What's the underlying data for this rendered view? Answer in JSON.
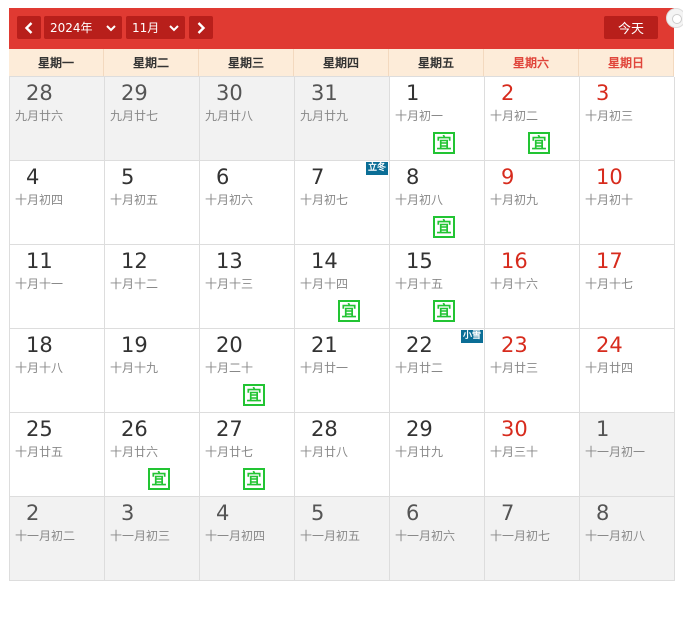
{
  "toolbar": {
    "year_label": "2024年",
    "month_label": "11月",
    "today_label": "今天",
    "prev_icon": "chevron-left-icon",
    "next_icon": "chevron-right-icon"
  },
  "weekdays": [
    {
      "label": "星期一",
      "weekend": false
    },
    {
      "label": "星期二",
      "weekend": false
    },
    {
      "label": "星期三",
      "weekend": false
    },
    {
      "label": "星期四",
      "weekend": false
    },
    {
      "label": "星期五",
      "weekend": false
    },
    {
      "label": "星期六",
      "weekend": true
    },
    {
      "label": "星期日",
      "weekend": true
    }
  ],
  "yi_label": "宜",
  "colors": {
    "toolbar_bg": "#e03a32",
    "button_bg": "#b81f1b",
    "weekend_text": "#d72b1d",
    "yi_green": "#22c433",
    "solar_term_badge": "#0b6e96"
  },
  "days": [
    {
      "day": "28",
      "lunar": "九月廿六",
      "other": true
    },
    {
      "day": "29",
      "lunar": "九月廿七",
      "other": true
    },
    {
      "day": "30",
      "lunar": "九月廿八",
      "other": true
    },
    {
      "day": "31",
      "lunar": "九月廿九",
      "other": true
    },
    {
      "day": "1",
      "lunar": "十月初一",
      "yi": true
    },
    {
      "day": "2",
      "lunar": "十月初二",
      "weekend": true,
      "yi": true
    },
    {
      "day": "3",
      "lunar": "十月初三",
      "weekend": true
    },
    {
      "day": "4",
      "lunar": "十月初四"
    },
    {
      "day": "5",
      "lunar": "十月初五"
    },
    {
      "day": "6",
      "lunar": "十月初六"
    },
    {
      "day": "7",
      "lunar": "十月初七",
      "term": "立冬"
    },
    {
      "day": "8",
      "lunar": "十月初八",
      "yi": true
    },
    {
      "day": "9",
      "lunar": "十月初九",
      "weekend": true
    },
    {
      "day": "10",
      "lunar": "十月初十",
      "weekend": true
    },
    {
      "day": "11",
      "lunar": "十月十一"
    },
    {
      "day": "12",
      "lunar": "十月十二"
    },
    {
      "day": "13",
      "lunar": "十月十三"
    },
    {
      "day": "14",
      "lunar": "十月十四",
      "yi": true
    },
    {
      "day": "15",
      "lunar": "十月十五",
      "yi": true
    },
    {
      "day": "16",
      "lunar": "十月十六",
      "weekend": true
    },
    {
      "day": "17",
      "lunar": "十月十七",
      "weekend": true
    },
    {
      "day": "18",
      "lunar": "十月十八"
    },
    {
      "day": "19",
      "lunar": "十月十九"
    },
    {
      "day": "20",
      "lunar": "十月二十",
      "yi": true
    },
    {
      "day": "21",
      "lunar": "十月廿一"
    },
    {
      "day": "22",
      "lunar": "十月廿二",
      "term": "小雪"
    },
    {
      "day": "23",
      "lunar": "十月廿三",
      "weekend": true
    },
    {
      "day": "24",
      "lunar": "十月廿四",
      "weekend": true
    },
    {
      "day": "25",
      "lunar": "十月廿五"
    },
    {
      "day": "26",
      "lunar": "十月廿六",
      "yi": true
    },
    {
      "day": "27",
      "lunar": "十月廿七",
      "yi": true
    },
    {
      "day": "28",
      "lunar": "十月廿八"
    },
    {
      "day": "29",
      "lunar": "十月廿九"
    },
    {
      "day": "30",
      "lunar": "十月三十",
      "weekend": true
    },
    {
      "day": "1",
      "lunar": "十一月初一",
      "weekend": true,
      "other": true
    },
    {
      "day": "2",
      "lunar": "十一月初二",
      "other": true
    },
    {
      "day": "3",
      "lunar": "十一月初三",
      "other": true
    },
    {
      "day": "4",
      "lunar": "十一月初四",
      "other": true
    },
    {
      "day": "5",
      "lunar": "十一月初五",
      "other": true
    },
    {
      "day": "6",
      "lunar": "十一月初六",
      "other": true
    },
    {
      "day": "7",
      "lunar": "十一月初七",
      "other": true
    },
    {
      "day": "8",
      "lunar": "十一月初八",
      "other": true
    }
  ]
}
